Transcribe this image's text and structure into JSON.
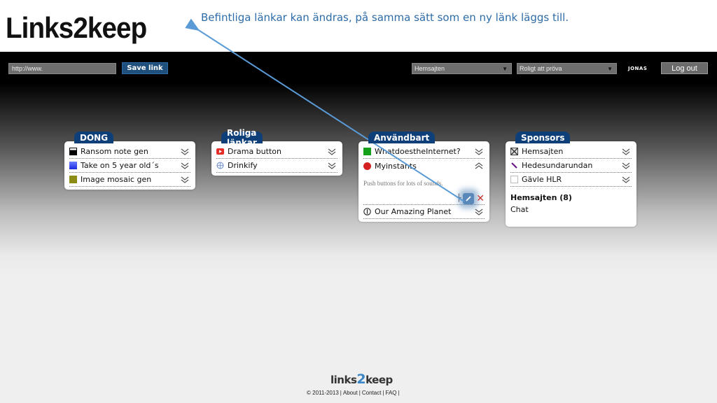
{
  "slide": {
    "title": "Links2keep",
    "annotation": "Befintliga länkar kan ändras, på samma sätt som en ny länk läggs till."
  },
  "topbar": {
    "url_placeholder": "http://www.",
    "save_label": "Save link",
    "select1_value": "Hemsajten",
    "select2_value": "Roligt att pröva",
    "username": "JONAS",
    "logout_label": "Log out"
  },
  "categories": [
    {
      "title": "DONG",
      "links": [
        {
          "label": "Ransom note gen",
          "icon": "black-square-favicon",
          "color": "#000000"
        },
        {
          "label": "Take on 5 year old´s",
          "icon": "blue-gradient-favicon",
          "color": "#2a3cff"
        },
        {
          "label": "Image mosaic gen",
          "icon": "olive-square-favicon",
          "color": "#8c8c14"
        }
      ]
    },
    {
      "title": "Roliga länkar",
      "links": [
        {
          "label": "Drama button",
          "icon": "youtube-icon",
          "color": "#e52d27"
        },
        {
          "label": "Drinkify",
          "icon": "globe-icon",
          "color": "#6c8ac8"
        }
      ]
    },
    {
      "title": "Användbart",
      "links": [
        {
          "label": "WhatdoestheInternet?",
          "icon": "green-square-favicon",
          "color": "#16a01a"
        },
        {
          "label": "Myinstants",
          "icon": "red-circle-favicon",
          "color": "#d42020"
        },
        {
          "label": "Our Amazing Planet",
          "icon": "info-circle-icon",
          "color": "#222222"
        }
      ],
      "expanded_description": "Push buttons for lots of sounds."
    },
    {
      "title": "Sponsors",
      "links": [
        {
          "label": "Hemsajten",
          "icon": "hourglass-favicon",
          "color": "#444444"
        },
        {
          "label": "Hedesundarundan",
          "icon": "brush-favicon",
          "color": "#6a1a8a"
        },
        {
          "label": "Gävle HLR",
          "icon": "blank-square-favicon",
          "color": "#cccccc"
        }
      ],
      "group_title": "Hemsajten (8)",
      "group_item": "Chat"
    }
  ],
  "footer": {
    "logo_prefix": "links",
    "logo_two": "2",
    "logo_suffix": "keep",
    "copyright": "© 2011-2013",
    "about": "About",
    "contact": "Contact",
    "faq": "FAQ"
  },
  "colors": {
    "category_tab": "#0e3f78",
    "annotation_arrow": "#5a9ad6",
    "save_button": "#1f4f7d"
  }
}
